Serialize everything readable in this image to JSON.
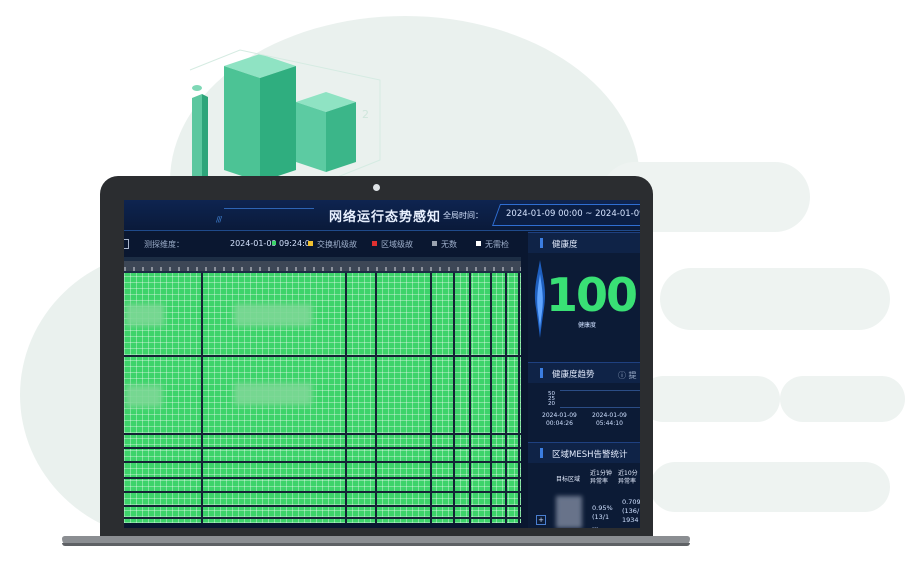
{
  "header": {
    "title": "网络运行态势感知",
    "time_label": "全局时间：",
    "time_range": "2024-01-09 00:00 ~ 2024-01-09"
  },
  "toolbar": {
    "dimension_label": "测探维度：",
    "timestamp": "2024-01-09 09:24:0",
    "legend": [
      {
        "label": "交换机级故",
        "color": "#f0c030"
      },
      {
        "label": "区域级故",
        "color": "#e03030"
      },
      {
        "label": "无数",
        "color": "#9aa3b0"
      },
      {
        "label": "无需检",
        "color": "#ffffff"
      }
    ]
  },
  "health": {
    "title": "健康度",
    "value": "100",
    "caption": "健康度",
    "color": "#39e075"
  },
  "trend": {
    "title": "健康度趋势",
    "info": "ⓘ 提",
    "y_ticks": [
      "50",
      "25",
      "20"
    ],
    "x_labels": [
      {
        "date": "2024-01-09",
        "time": "00:04:26"
      },
      {
        "date": "2024-01-09",
        "time": "05:44:10"
      }
    ]
  },
  "mesh": {
    "title": "区域MESH告警统计",
    "columns": [
      "目标区域",
      "近1分钟\n异常率",
      "近10分\n异常率"
    ],
    "row": {
      "expand": "+",
      "col1": [
        "0.95%",
        "(13/1",
        "..."
      ],
      "col2": [
        "0.709",
        "(136/",
        "1934"
      ]
    }
  },
  "colors": {
    "heatmap_ok": "#3dd36a",
    "panel_bg": "#0a1730",
    "accent": "#2f6ed2"
  }
}
